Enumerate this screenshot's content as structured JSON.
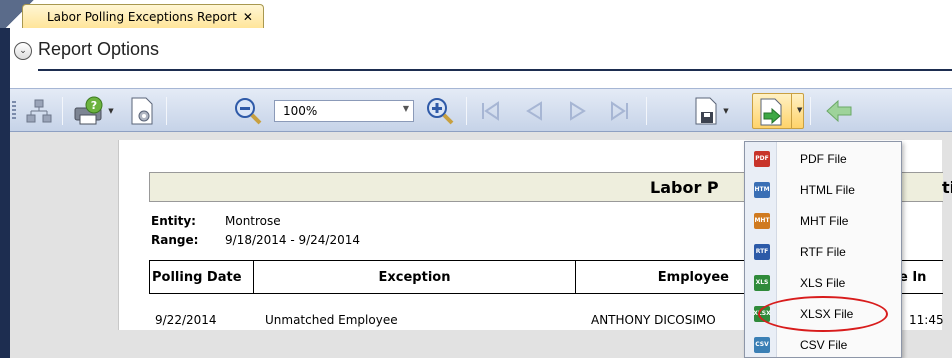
{
  "tab": {
    "title": "Labor Polling Exceptions Report",
    "close": "✕"
  },
  "options": {
    "title": "Report Options"
  },
  "toolbar": {
    "zoom_value": "100%",
    "icons": [
      "document-map-icon",
      "print-icon",
      "page-setup-icon",
      "zoom-out-icon",
      "zoom-in-icon",
      "first-page-icon",
      "previous-page-icon",
      "next-page-icon",
      "last-page-icon",
      "save-icon",
      "export-icon",
      "back-icon"
    ]
  },
  "report": {
    "title": "Labor P",
    "title_tail": "tions",
    "entity_label": "Entity:",
    "entity_value": "Montrose",
    "range_label": "Range:",
    "range_value": "9/18/2014 - 9/24/2014",
    "columns": [
      "Polling Date",
      "Exception",
      "Employee",
      "e In"
    ],
    "rows": [
      {
        "polling_date": "9/22/2014",
        "exception": "Unmatched Employee",
        "employee": "ANTHONY DICOSIMO",
        "time_in": "11:45"
      }
    ]
  },
  "export_menu": {
    "items": [
      {
        "label": "PDF File",
        "icon_text": "PDF",
        "color": "#c8342a"
      },
      {
        "label": "HTML File",
        "icon_text": "HTM",
        "color": "#3a6fb5"
      },
      {
        "label": "MHT File",
        "icon_text": "MHT",
        "color": "#d07a1f"
      },
      {
        "label": "RTF File",
        "icon_text": "RTF",
        "color": "#2c5aa8"
      },
      {
        "label": "XLS File",
        "icon_text": "XLS",
        "color": "#2f8a3a"
      },
      {
        "label": "XLSX File",
        "icon_text": "XLSX",
        "color": "#2f8a3a"
      },
      {
        "label": "CSV File",
        "icon_text": "CSV",
        "color": "#3a7fb5"
      }
    ],
    "highlight_color": "#d81c1c"
  }
}
